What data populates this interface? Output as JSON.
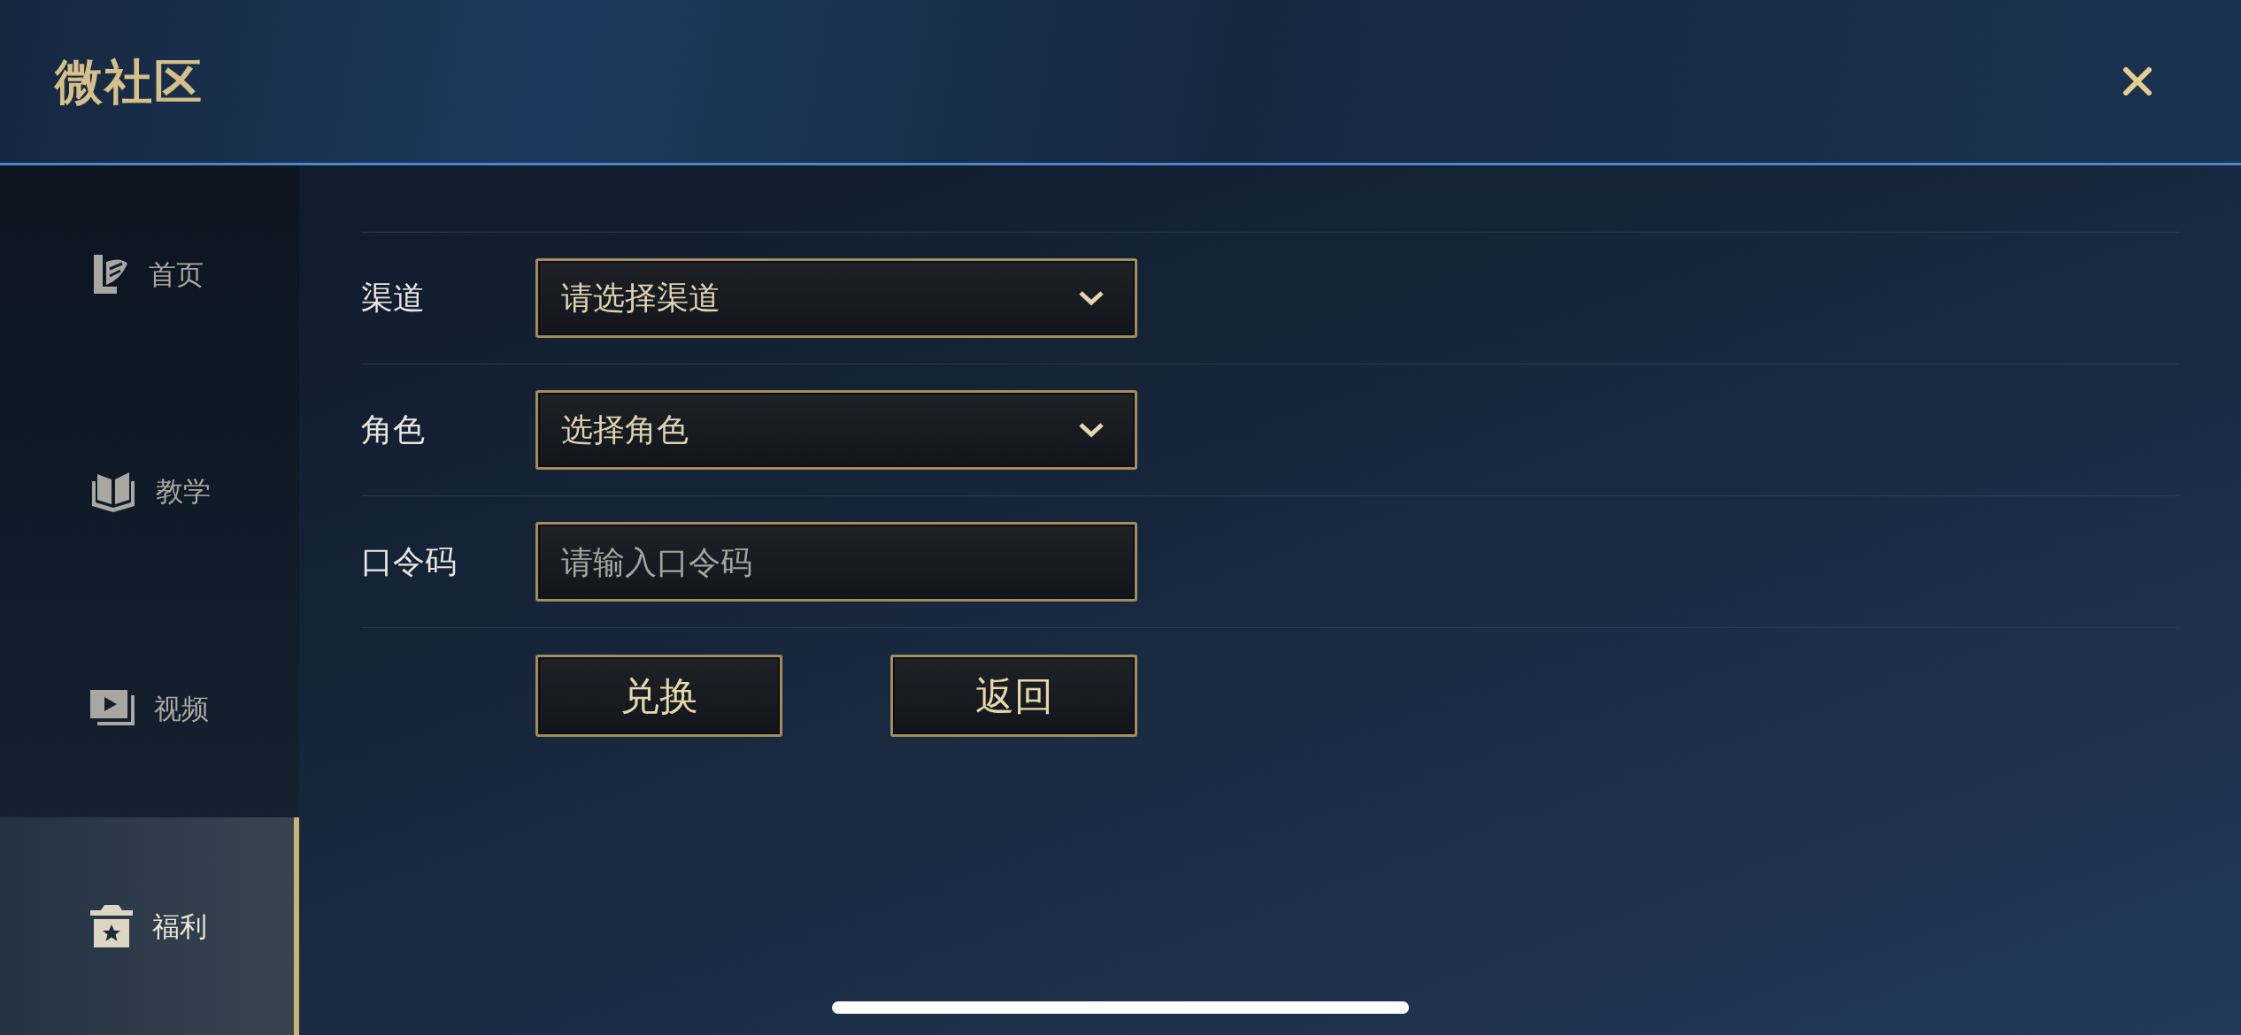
{
  "header": {
    "title": "微社区"
  },
  "sidebar": {
    "items": [
      {
        "label": "首页",
        "selected": false
      },
      {
        "label": "教学",
        "selected": false
      },
      {
        "label": "视频",
        "selected": false
      },
      {
        "label": "福利",
        "selected": true
      }
    ]
  },
  "form": {
    "rows": [
      {
        "kind": "dropdown",
        "label": "渠道",
        "placeholder": "请选择渠道"
      },
      {
        "kind": "dropdown",
        "label": "角色",
        "placeholder": "选择角色"
      },
      {
        "kind": "input",
        "label": "口令码",
        "placeholder": "请输入口令码"
      }
    ],
    "buttons": [
      "兑换",
      "返回"
    ]
  }
}
